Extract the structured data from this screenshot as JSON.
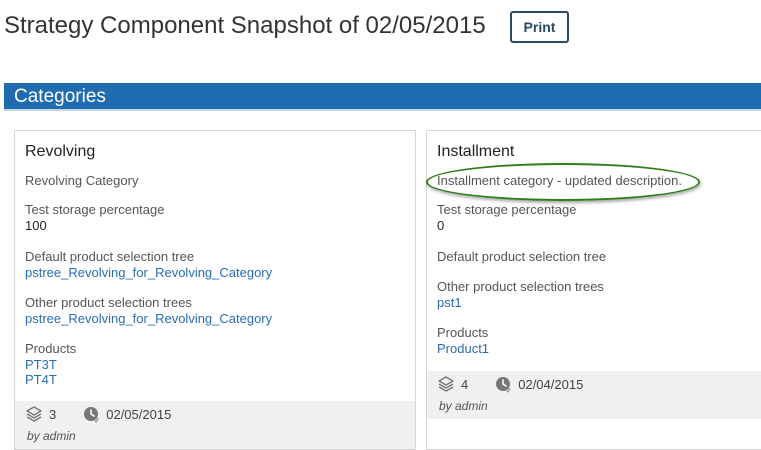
{
  "header": {
    "title": "Strategy Component Snapshot of 02/05/2015",
    "print_label": "Print"
  },
  "section": {
    "title": "Categories"
  },
  "cards": [
    {
      "title": "Revolving",
      "description": "Revolving Category",
      "storage_label": "Test storage percentage",
      "storage_value": "100",
      "default_tree_label": "Default product selection tree",
      "default_tree_link": "pstree_Revolving_for_Revolving_Category",
      "other_trees_label": "Other product selection trees",
      "other_trees_links": [
        "pstree_Revolving_for_Revolving_Category"
      ],
      "products_label": "Products",
      "products": [
        "PT3T",
        "PT4T"
      ],
      "version_count": "3",
      "date": "02/05/2015",
      "by": "by admin"
    },
    {
      "title": "Installment",
      "description": "Installment category - updated description.",
      "storage_label": "Test storage percentage",
      "storage_value": "0",
      "default_tree_label": "Default product selection tree",
      "default_tree_link": "",
      "other_trees_label": "Other product selection trees",
      "other_trees_links": [
        "pst1"
      ],
      "products_label": "Products",
      "products": [
        "Product1"
      ],
      "version_count": "4",
      "date": "02/04/2015",
      "by": "by admin"
    }
  ],
  "icons": {
    "versions": "layers-icon",
    "date": "clock-history-icon"
  },
  "colors": {
    "section_bar": "#1f6cb0",
    "link": "#2a6db5",
    "highlight": "#2e7d1a",
    "print_border": "#2a4a6a"
  }
}
